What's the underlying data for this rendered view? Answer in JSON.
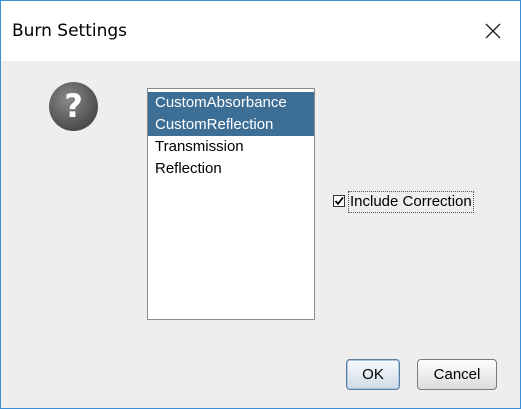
{
  "window": {
    "title": "Burn Settings"
  },
  "icons": {
    "message_icon": "question-icon",
    "close_icon": "close-icon"
  },
  "list": {
    "items": [
      {
        "label": "CustomAbsorbance",
        "selected": true
      },
      {
        "label": "CustomReflection",
        "selected": true
      },
      {
        "label": "Transmission",
        "selected": false
      },
      {
        "label": "Reflection",
        "selected": false
      }
    ]
  },
  "options": {
    "include_correction": {
      "label": "Include Correction",
      "checked": true
    }
  },
  "buttons": {
    "ok_label": "OK",
    "cancel_label": "Cancel"
  },
  "colors": {
    "selection_background": "#3d6e96",
    "window_border": "#3c8fd6",
    "dialog_background": "#eeeeee"
  }
}
